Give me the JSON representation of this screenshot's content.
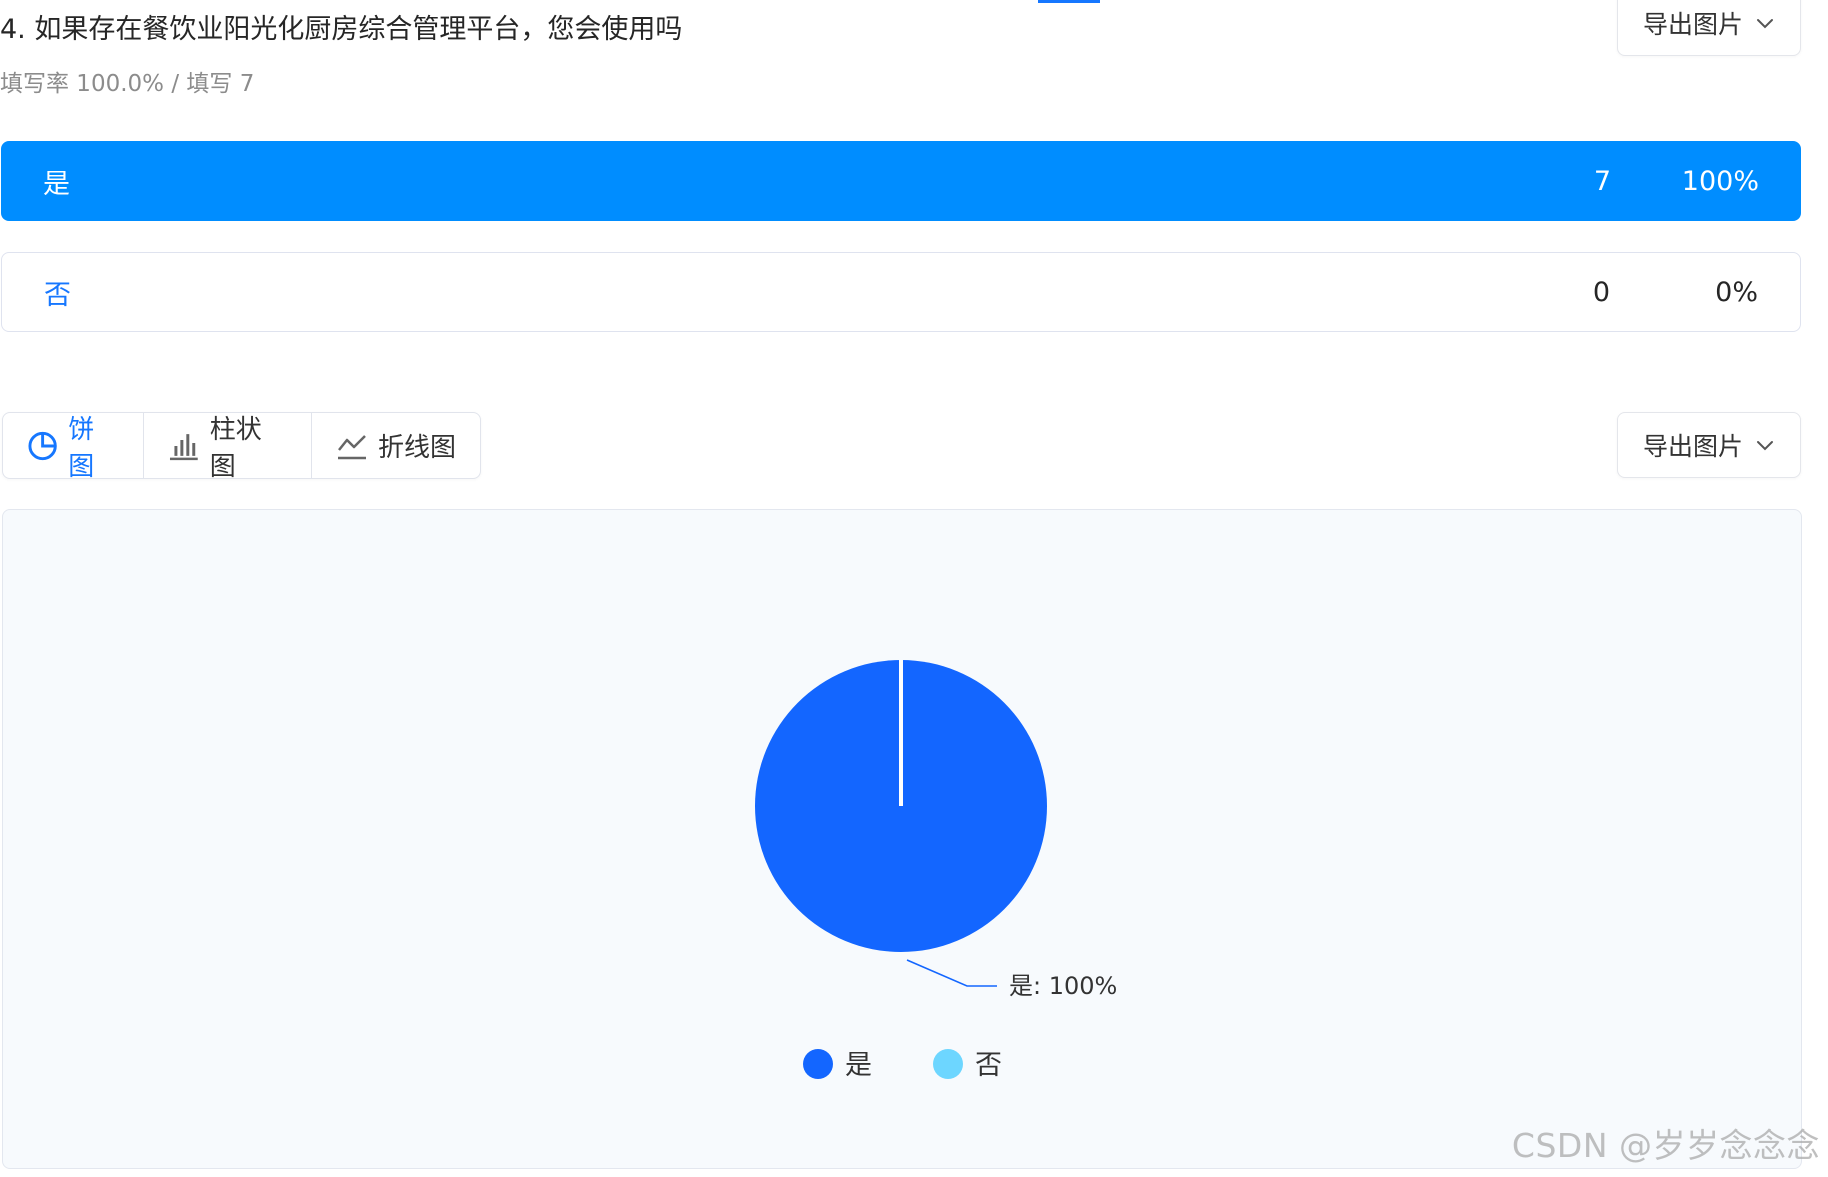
{
  "question": {
    "title": "4. 如果存在餐饮业阳光化厨房综合管理平台，您会使用吗",
    "meta": "填写率 100.0% / 填写 7"
  },
  "export_label": "导出图片",
  "options": [
    {
      "label": "是",
      "count": "7",
      "percent": "100%",
      "selected": true
    },
    {
      "label": "否",
      "count": "0",
      "percent": "0%",
      "selected": false
    }
  ],
  "chart_tabs": [
    {
      "label": "饼图",
      "icon": "pie-chart-icon",
      "active": true
    },
    {
      "label": "柱状图",
      "icon": "bar-chart-icon",
      "active": false
    },
    {
      "label": "折线图",
      "icon": "line-chart-icon",
      "active": false
    }
  ],
  "chart_data": {
    "type": "pie",
    "slices": [
      {
        "label": "是",
        "value": 100,
        "color": "#1366ff"
      },
      {
        "label": "否",
        "value": 0,
        "color": "#6dd6ff"
      }
    ],
    "annotation": "是: 100%",
    "legend": [
      "是",
      "否"
    ],
    "legend_placement": "bottom"
  },
  "colors": {
    "accent": "#008dff",
    "active_tab": "#1677ff"
  },
  "watermark": "CSDN @岁岁念念念"
}
